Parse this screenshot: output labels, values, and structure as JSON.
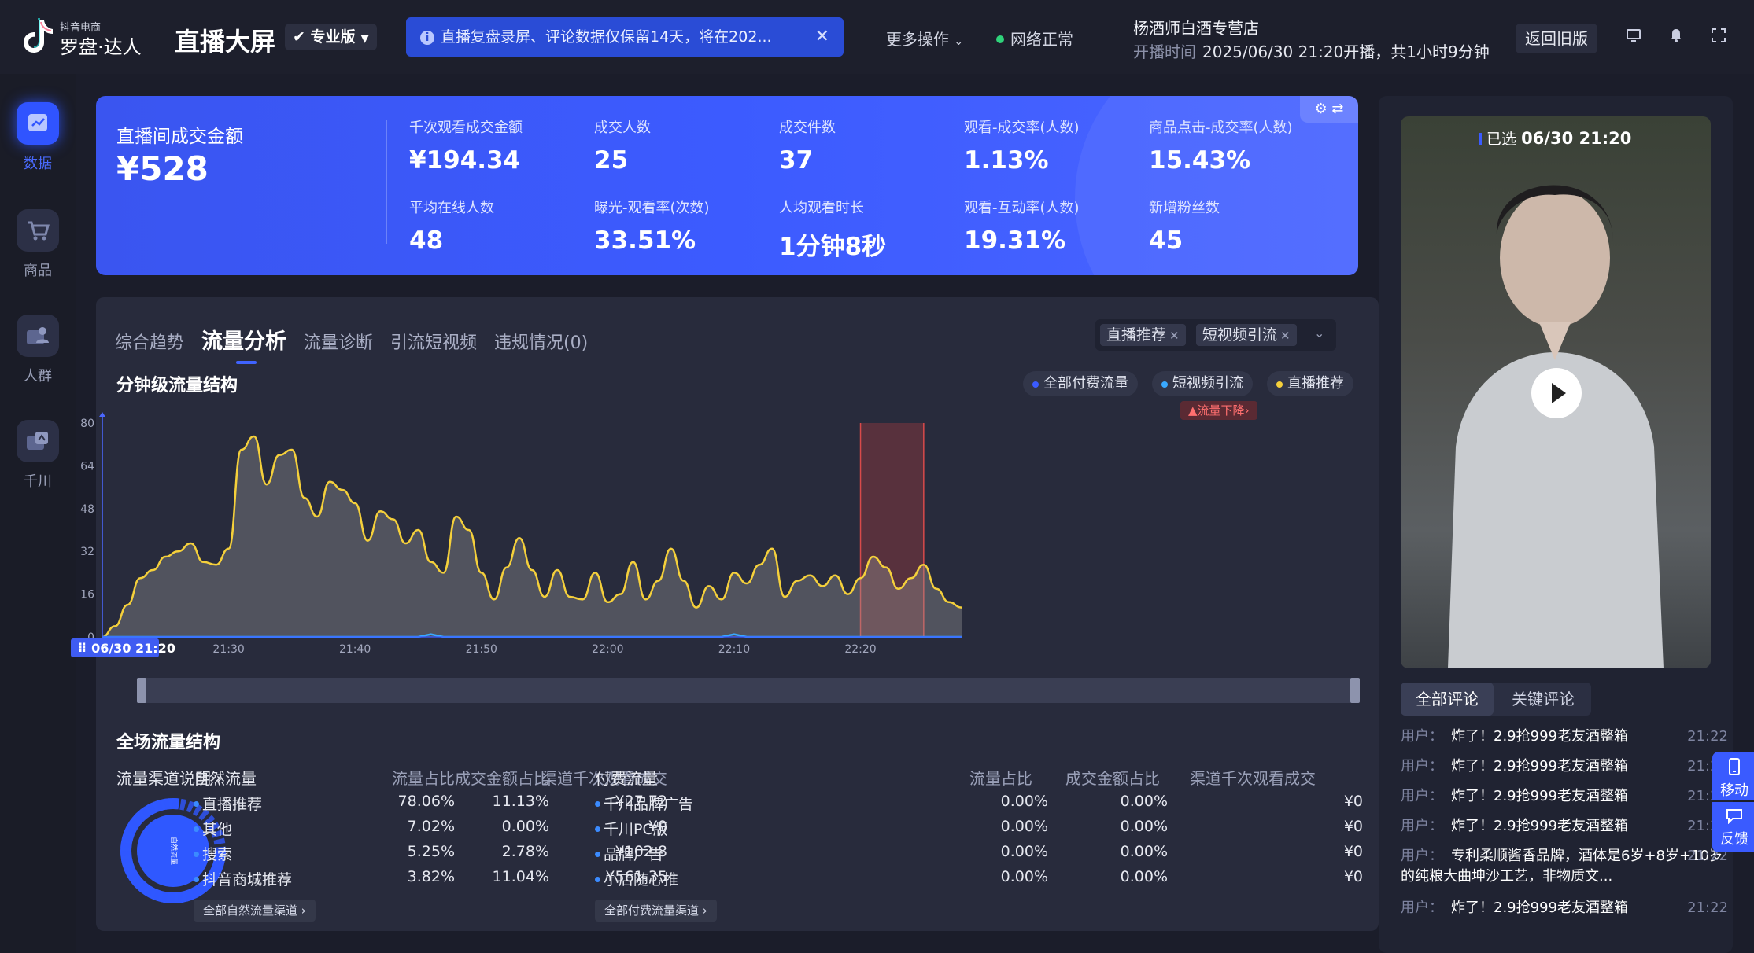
{
  "topbar": {
    "logo_small": "抖音电商",
    "logo_big": "罗盘·达人",
    "app_title": "直播大屏",
    "edition": "专业版",
    "notice": "直播复盘录屏、评论数据仅保留14天，将在202...",
    "more_ops": "更多操作",
    "network": "网络正常",
    "shop_name": "杨酒师白酒专营店",
    "start_label": "开播时间",
    "start_value": "2025/06/30 21:20开播，共1小时9分钟",
    "back_old": "返回旧版"
  },
  "sidebar": {
    "items": [
      {
        "label": "数据",
        "icon": "data-icon"
      },
      {
        "label": "商品",
        "icon": "cart-icon"
      },
      {
        "label": "人群",
        "icon": "people-icon"
      },
      {
        "label": "千川",
        "icon": "qianchuan-icon"
      }
    ]
  },
  "kpi": {
    "main_label": "直播间成交金额",
    "main_value": "¥528",
    "cells": [
      {
        "label": "千次观看成交金额",
        "value": "¥194.34"
      },
      {
        "label": "成交人数",
        "value": "25"
      },
      {
        "label": "成交件数",
        "value": "37"
      },
      {
        "label": "观看-成交率(人数)",
        "value": "1.13%"
      },
      {
        "label": "商品点击-成交率(人数)",
        "value": "15.43%"
      },
      {
        "label": "平均在线人数",
        "value": "48"
      },
      {
        "label": "曝光-观看率(次数)",
        "value": "33.51%"
      },
      {
        "label": "人均观看时长",
        "value": "1分钟8秒"
      },
      {
        "label": "观看-互动率(人数)",
        "value": "19.31%"
      },
      {
        "label": "新增粉丝数",
        "value": "45"
      }
    ]
  },
  "panel": {
    "tabs": [
      "综合趋势",
      "流量分析",
      "流量诊断",
      "引流短视频",
      "违规情况(0)"
    ],
    "filters": [
      "直播推荐",
      "短视频引流"
    ],
    "chart_title": "分钟级流量结构",
    "legend": [
      {
        "name": "全部付费流量",
        "color": "#3b5bff"
      },
      {
        "name": "短视频引流",
        "color": "#39a9ff"
      },
      {
        "name": "直播推荐",
        "color": "#f5d03b"
      }
    ],
    "drop_tag": "流量下降",
    "start_marker": "06/30 21:20",
    "overall_title": "全场流量结构",
    "channel_help": "流量渠道说明",
    "donut_label": "自然流量"
  },
  "natural": {
    "headers": [
      "自然流量",
      "流量占比",
      "成交金额占比",
      "渠道千次观看成交"
    ],
    "rows": [
      [
        "直播推荐",
        "78.06%",
        "11.13%",
        "¥27.72"
      ],
      [
        "其他",
        "7.02%",
        "0.00%",
        "¥0"
      ],
      [
        "搜索",
        "5.25%",
        "2.78%",
        "¥102.8"
      ],
      [
        "抖音商城推荐",
        "3.82%",
        "11.04%",
        "¥561.35"
      ]
    ],
    "all_btn": "全部自然流量渠道"
  },
  "paid": {
    "headers": [
      "付费流量",
      "流量占比",
      "成交金额占比",
      "渠道千次观看成交"
    ],
    "rows": [
      [
        "千川品牌广告",
        "0.00%",
        "0.00%",
        "¥0"
      ],
      [
        "千川PC版",
        "0.00%",
        "0.00%",
        "¥0"
      ],
      [
        "品牌广告",
        "0.00%",
        "0.00%",
        "¥0"
      ],
      [
        "小店随心推",
        "0.00%",
        "0.00%",
        "¥0"
      ]
    ],
    "all_btn": "全部付费流量渠道"
  },
  "video": {
    "selected_label": "已选",
    "selected_time": "06/30 21:20"
  },
  "comments": {
    "tabs": [
      "全部评论",
      "关键评论"
    ],
    "user_label": "用户：",
    "items": [
      {
        "text": "炸了！2.9抢999老友酒整箱",
        "time": "21:22"
      },
      {
        "text": "炸了！2.9抢999老友酒整箱",
        "time": "21:22"
      },
      {
        "text": "炸了！2.9抢999老友酒整箱",
        "time": "21:22"
      },
      {
        "text": "炸了！2.9抢999老友酒整箱",
        "time": "21:22"
      },
      {
        "text": "专利柔顺酱香品牌，酒体是6岁+8岁+10岁的纯粮大曲坤沙工艺，非物质文...",
        "time": "21:22"
      },
      {
        "text": "炸了！2.9抢999老友酒整箱",
        "time": "21:22"
      }
    ]
  },
  "float": {
    "mobile": "移动",
    "feedback": "反馈"
  },
  "chart_data": {
    "type": "area",
    "title": "分钟级流量结构",
    "x_ticks": [
      "06/30 21:20",
      "21:30",
      "21:40",
      "21:50",
      "22:00",
      "22:10",
      "22:20"
    ],
    "x_start_minute": 0,
    "x_end_minute": 68,
    "ylim": [
      0,
      80
    ],
    "y_ticks": [
      0,
      16,
      32,
      48,
      64,
      80
    ],
    "highlight_range_minutes": [
      60,
      65
    ],
    "series": [
      {
        "name": "直播推荐",
        "color": "#f5d03b",
        "x": [
          0,
          1,
          2,
          3,
          4,
          5,
          6,
          7,
          8,
          9,
          10,
          11,
          12,
          13,
          14,
          15,
          16,
          17,
          18,
          19,
          20,
          21,
          22,
          23,
          24,
          25,
          26,
          27,
          28,
          29,
          30,
          31,
          32,
          33,
          34,
          35,
          36,
          37,
          38,
          39,
          40,
          41,
          42,
          43,
          44,
          45,
          46,
          47,
          48,
          49,
          50,
          51,
          52,
          53,
          54,
          55,
          56,
          57,
          58,
          59,
          60,
          61,
          62,
          63,
          64,
          65,
          66,
          67,
          68
        ],
        "values": [
          0,
          4,
          12,
          22,
          25,
          30,
          32,
          35,
          28,
          27,
          33,
          70,
          75,
          57,
          68,
          70,
          52,
          45,
          58,
          55,
          50,
          36,
          47,
          44,
          35,
          40,
          28,
          24,
          45,
          40,
          24,
          14,
          26,
          37,
          25,
          15,
          25,
          15,
          14,
          24,
          13,
          16,
          28,
          14,
          21,
          33,
          21,
          11,
          19,
          14,
          24,
          20,
          27,
          33,
          15,
          21,
          23,
          19,
          23,
          16,
          22,
          30,
          26,
          18,
          22,
          27,
          18,
          13,
          11
        ]
      },
      {
        "name": "短视频引流",
        "color": "#39a9ff",
        "x": [
          0,
          10,
          20,
          25,
          26,
          27,
          30,
          40,
          49,
          50,
          51,
          60,
          68
        ],
        "values": [
          0,
          0,
          0,
          0,
          1,
          0,
          0,
          0,
          0,
          1,
          0,
          0,
          0
        ]
      },
      {
        "name": "全部付费流量",
        "color": "#3b5bff",
        "x": [
          0,
          68
        ],
        "values": [
          0,
          0
        ]
      }
    ]
  }
}
